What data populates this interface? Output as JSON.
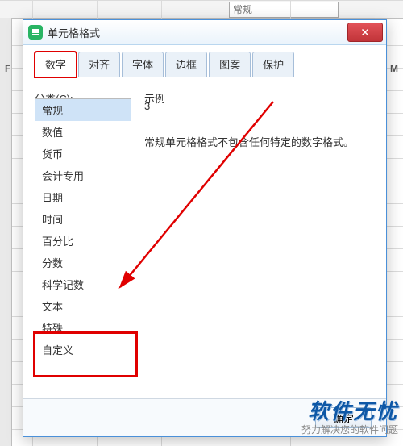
{
  "background": {
    "format_dropdown": "常规",
    "col_F": "F",
    "col_M": "M"
  },
  "dialog": {
    "title": "单元格格式",
    "tabs": [
      "数字",
      "对齐",
      "字体",
      "边框",
      "图案",
      "保护"
    ],
    "active_tab_index": 0,
    "category_label": "分类(C):",
    "categories": [
      "常规",
      "数值",
      "货币",
      "会计专用",
      "日期",
      "时间",
      "百分比",
      "分数",
      "科学记数",
      "文本",
      "特殊",
      "自定义"
    ],
    "selected_category_index": 0,
    "highlighted_category_index": 11,
    "example_label": "示例",
    "example_value": "3",
    "description": "常规单元格格式不包含任何特定的数字格式。",
    "ok_label": "确定"
  },
  "watermark": {
    "main": "软件无忧",
    "sub": "努力解决您的软件问题"
  }
}
